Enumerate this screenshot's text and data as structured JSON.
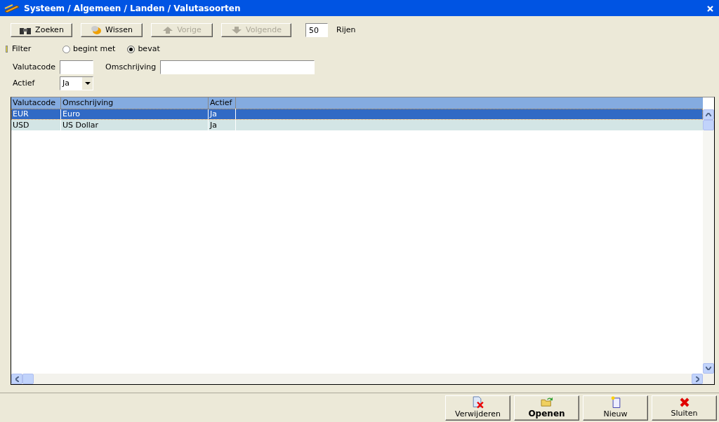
{
  "window": {
    "title": "Systeem / Algemeen / Landen / Valutasoorten"
  },
  "toolbar": {
    "buttons": [
      {
        "label": "Zoeken",
        "kind": "search",
        "disabled": false
      },
      {
        "label": "Wissen",
        "kind": "erase",
        "disabled": false
      },
      {
        "label": "Vorige",
        "kind": "up",
        "disabled": true
      },
      {
        "label": "Volgende",
        "kind": "down",
        "disabled": true
      }
    ],
    "rows_value": "50",
    "rows_label": "Rijen"
  },
  "filter": {
    "label": "Filter",
    "options": [
      {
        "label": "begint met",
        "selected": false
      },
      {
        "label": "bevat",
        "selected": true
      }
    ],
    "code_label": "Valutacode",
    "description_label": "Omschrijving",
    "active_label": "Actief",
    "active_value": "Ja"
  },
  "table": {
    "columns": [
      "Valutacode",
      "Omschrijving",
      "Actief"
    ],
    "rows": [
      {
        "cells": [
          "EUR",
          "Euro",
          "Ja"
        ],
        "selected": true
      },
      {
        "cells": [
          "USD",
          "US Dollar",
          "Ja"
        ],
        "selected": false
      }
    ]
  },
  "footer": {
    "buttons": [
      {
        "label": "Verwijderen",
        "kind": "delete",
        "default": false
      },
      {
        "label": "Openen",
        "kind": "open",
        "default": true
      },
      {
        "label": "Nieuw",
        "kind": "new",
        "default": false
      },
      {
        "label": "Sluiten",
        "kind": "close",
        "default": false
      }
    ]
  }
}
